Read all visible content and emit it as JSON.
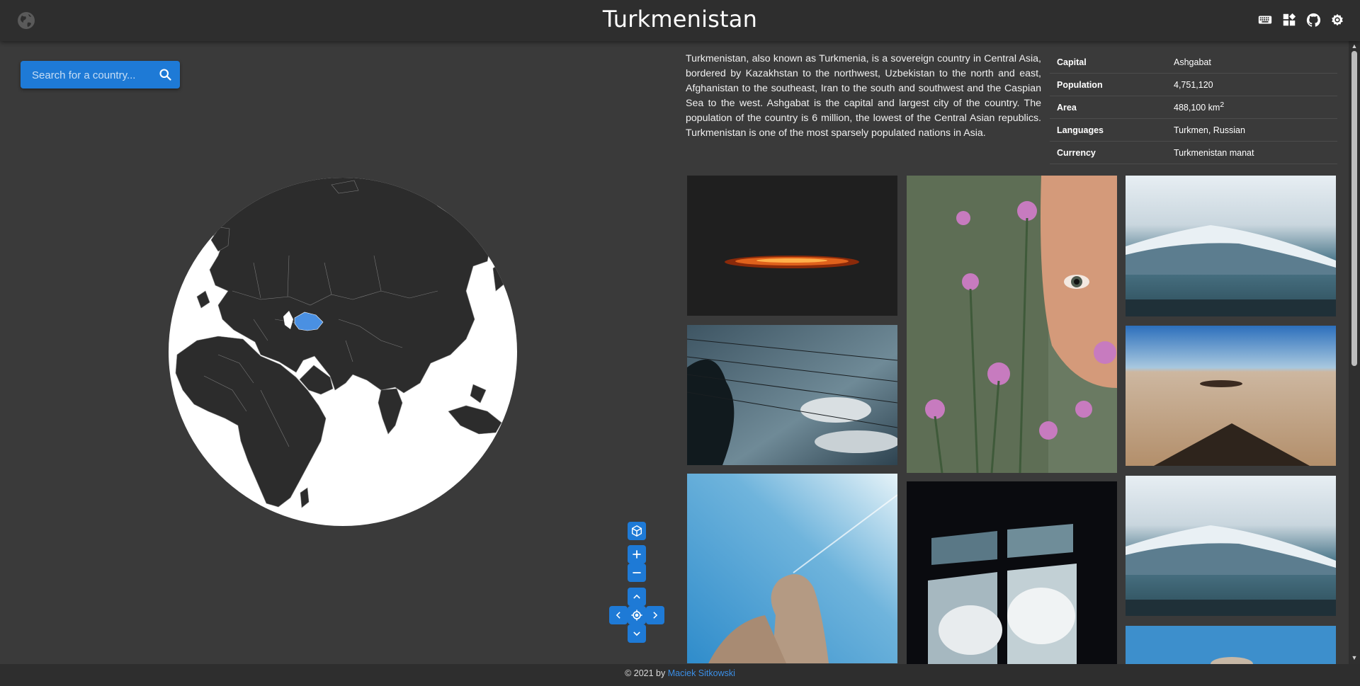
{
  "header": {
    "title": "Turkmenistan",
    "icons": [
      "globe-icon",
      "keyboard-icon",
      "dashboard-icon",
      "github-icon",
      "settings-icon"
    ]
  },
  "search": {
    "placeholder": "Search for a country..."
  },
  "country": {
    "description": "Turkmenistan, also known as Turkmenia, is a sovereign country in Central Asia, bordered by Kazakhstan to the northwest, Uzbekistan to the north and east, Afghanistan to the southeast, Iran to the south and southwest and the Caspian Sea to the west. Ashgabat is the capital and largest city of the country. The population of the country is 6 million, the lowest of the Central Asian republics. Turkmenistan is one of the most sparsely populated nations in Asia.",
    "facts": [
      {
        "label": "Capital",
        "value": "Ashgabat"
      },
      {
        "label": "Population",
        "value": "4,751,120"
      },
      {
        "label": "Area",
        "value": "488,100 km",
        "sup": "2"
      },
      {
        "label": "Languages",
        "value": "Turkmen, Russian"
      },
      {
        "label": "Currency",
        "value": "Turkmenistan manat"
      }
    ]
  },
  "map_controls": [
    "cube-icon",
    "zoom-in-icon",
    "zoom-out-icon",
    "pan-up-icon",
    "pan-left-icon",
    "locate-icon",
    "pan-right-icon",
    "pan-down-icon"
  ],
  "footer": {
    "text": "© 2021 by ",
    "author": "Maciek Sitkowski"
  },
  "colors": {
    "accent": "#1e7ad6",
    "highlight_country": "#4a90e2",
    "background": "#3a3a3a",
    "topbar": "#2e2e2e"
  }
}
